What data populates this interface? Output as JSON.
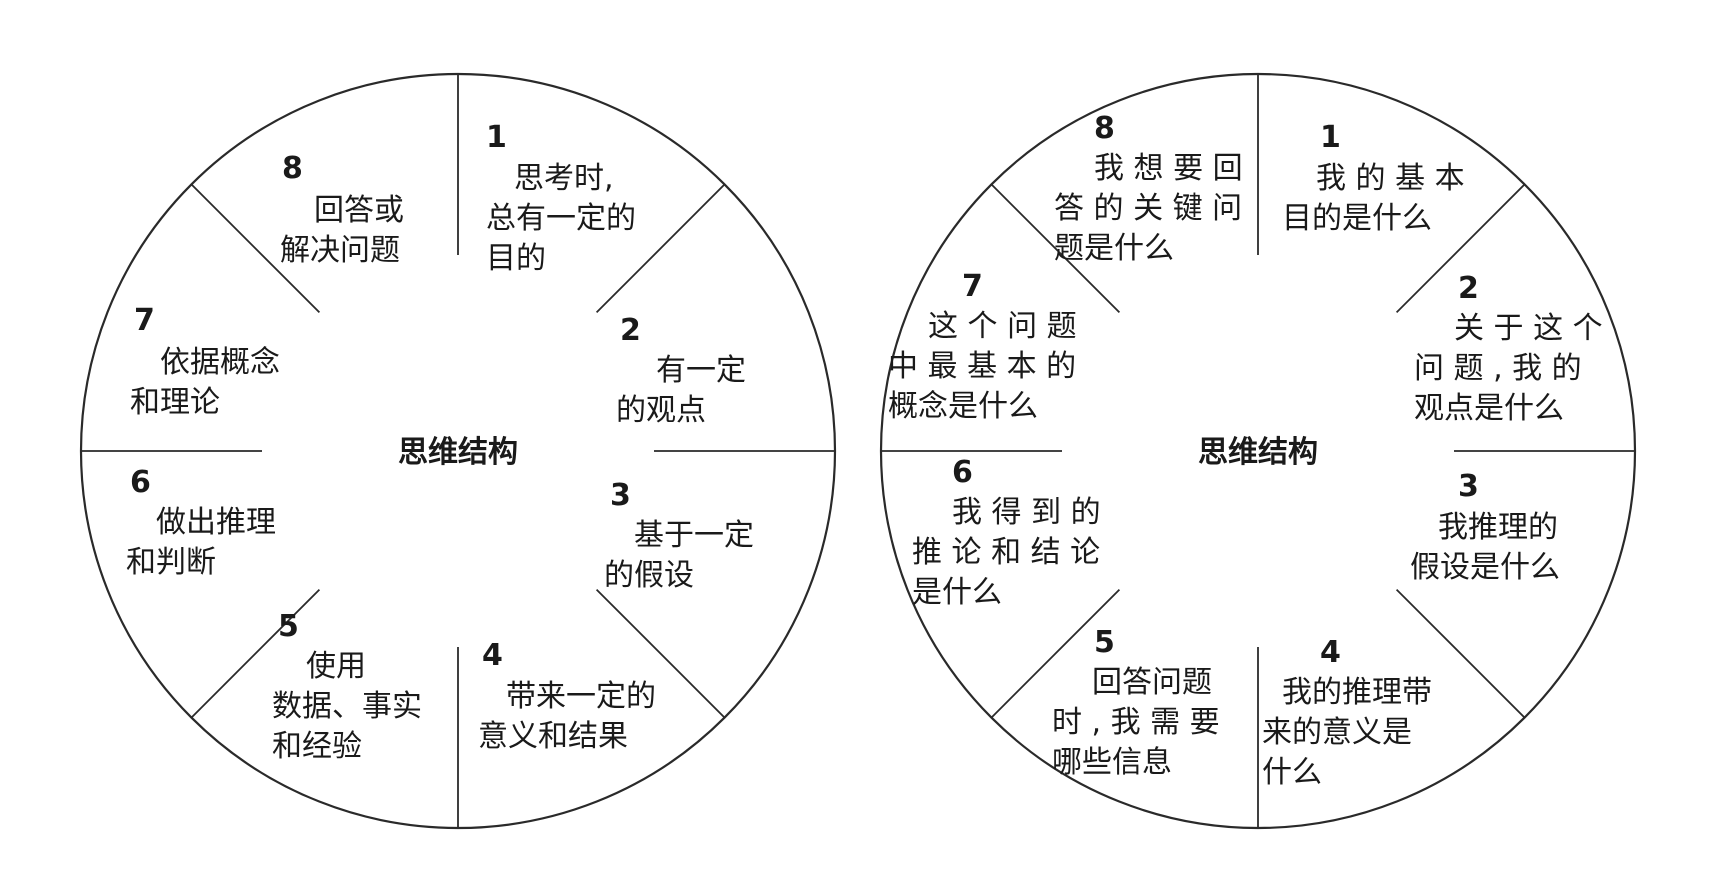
{
  "diagrams": [
    {
      "center_label": "思维结构",
      "segments": [
        {
          "number": "1",
          "lines": [
            "思考时,",
            "总有一定的",
            "目的"
          ]
        },
        {
          "number": "2",
          "lines": [
            "有一定",
            "的观点"
          ]
        },
        {
          "number": "3",
          "lines": [
            "基于一定",
            "的假设"
          ]
        },
        {
          "number": "4",
          "lines": [
            "带来一定的",
            "意义和结果"
          ]
        },
        {
          "number": "5",
          "lines": [
            "使用",
            "数据、事实",
            "和经验"
          ]
        },
        {
          "number": "6",
          "lines": [
            "做出推理",
            "和判断"
          ]
        },
        {
          "number": "7",
          "lines": [
            "依据概念",
            "和理论"
          ]
        },
        {
          "number": "8",
          "lines": [
            "回答或",
            "解决问题"
          ]
        }
      ]
    },
    {
      "center_label": "思维结构",
      "segments": [
        {
          "number": "1",
          "lines": [
            "我 的 基 本",
            "目的是什么"
          ]
        },
        {
          "number": "2",
          "lines": [
            "关 于 这 个",
            "问 题 , 我 的",
            "观点是什么"
          ]
        },
        {
          "number": "3",
          "lines": [
            "我推理的",
            "假设是什么"
          ]
        },
        {
          "number": "4",
          "lines": [
            "我的推理带",
            "来的意义是",
            "什么"
          ]
        },
        {
          "number": "5",
          "lines": [
            "回答问题",
            "时 , 我 需 要",
            "哪些信息"
          ]
        },
        {
          "number": "6",
          "lines": [
            "我 得 到 的",
            "推 论 和 结 论",
            "是什么"
          ]
        },
        {
          "number": "7",
          "lines": [
            "这 个 问 题",
            "中 最 基 本 的",
            "概念是什么"
          ]
        },
        {
          "number": "8",
          "lines": [
            "我 想 要 回",
            "答 的 关 键 问",
            "题是什么"
          ]
        }
      ]
    }
  ]
}
